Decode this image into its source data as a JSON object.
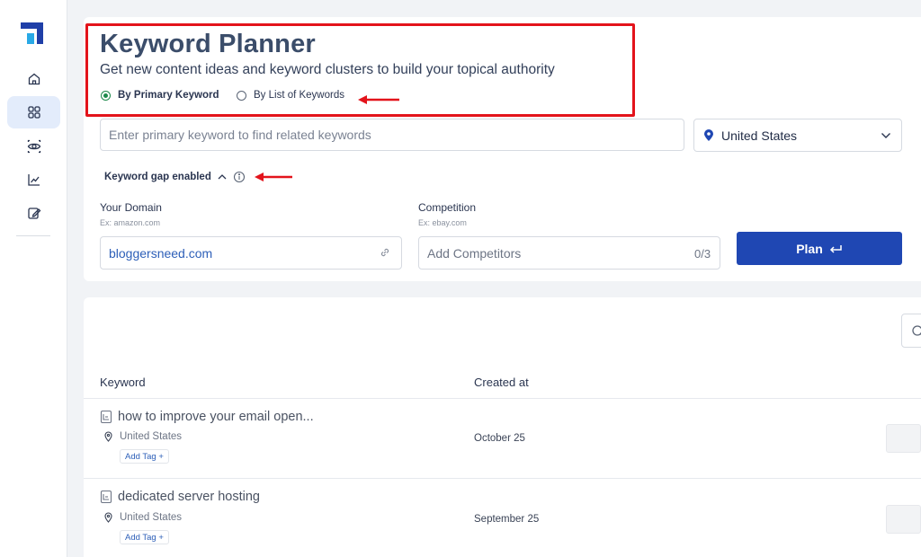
{
  "header": {
    "title": "Keyword Planner",
    "subtitle": "Get new content ideas and keyword clusters to build your topical authority"
  },
  "mode_options": [
    {
      "label": "By Primary Keyword",
      "selected": true
    },
    {
      "label": "By List of Keywords",
      "selected": false
    }
  ],
  "search": {
    "placeholder": "Enter primary keyword to find related keywords",
    "value": ""
  },
  "country": {
    "selected": "United States"
  },
  "keyword_gap": {
    "label": "Keyword gap enabled"
  },
  "domain": {
    "label": "Your Domain",
    "hint": "Ex: amazon.com",
    "value": "bloggersneed.com"
  },
  "competition": {
    "label": "Competition",
    "hint": "Ex: ebay.com",
    "placeholder": "Add Competitors",
    "count": "0/3"
  },
  "plan_button": {
    "label": "Plan"
  },
  "table": {
    "headers": [
      "Keyword",
      "Created at"
    ],
    "rows": [
      {
        "keyword": "how to improve your email open...",
        "location": "United States",
        "tag_label": "Add Tag +",
        "created_at": "October 25"
      },
      {
        "keyword": "dedicated server hosting",
        "location": "United States",
        "tag_label": "Add Tag +",
        "created_at": "September 25"
      }
    ]
  },
  "sidebar": {
    "items": [
      "home-icon",
      "grid-icon",
      "eye-icon",
      "chart-icon",
      "edit-icon"
    ],
    "active": "grid-icon"
  },
  "colors": {
    "brand": "#1f47b3",
    "annotation": "#e3131b",
    "radio_selected": "#1e8a4c",
    "logo_dark": "#1f3fa8",
    "logo_light": "#29a9e6"
  }
}
